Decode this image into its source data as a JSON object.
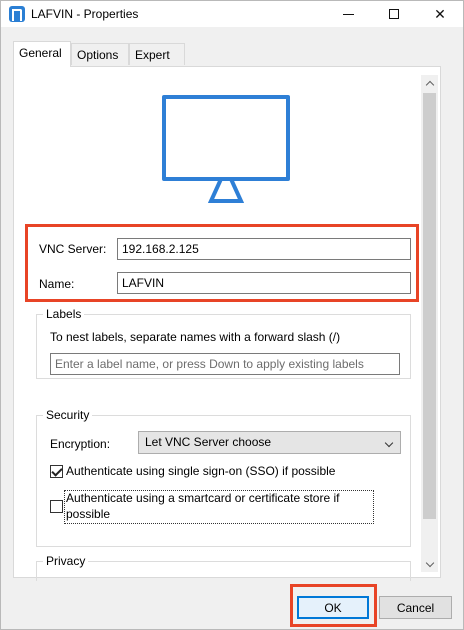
{
  "window": {
    "title": "LAFVIN - Properties",
    "icon": "realvnc-logo-icon",
    "controls": {
      "minimize": "minimize-icon",
      "maximize": "maximize-icon",
      "close": "✕"
    }
  },
  "tabs": [
    {
      "label": "General",
      "active": true
    },
    {
      "label": "Options",
      "active": false
    },
    {
      "label": "Expert",
      "active": false
    }
  ],
  "general": {
    "illustration": "monitor-icon",
    "vnc_server_label": "VNC Server:",
    "vnc_server_value": "192.168.2.125",
    "name_label": "Name:",
    "name_value": "LAFVIN",
    "labels_section": {
      "title": "Labels",
      "description": "To nest labels, separate names with a forward slash (/)",
      "placeholder": "Enter a label name, or press Down to apply existing labels"
    },
    "security_section": {
      "title": "Security",
      "encryption_label": "Encryption:",
      "encryption_value": "Let VNC Server choose",
      "sso_label": "Authenticate using single sign-on (SSO) if possible",
      "sso_checked": true,
      "smartcard_label_line1": "Authenticate using a smartcard or certificate store if",
      "smartcard_label_line2": "possible",
      "smartcard_checked": false
    },
    "privacy_section": {
      "title": "Privacy"
    }
  },
  "buttons": {
    "ok": "OK",
    "cancel": "Cancel"
  },
  "colors": {
    "accent": "#2e7fd6",
    "highlight": "#e84426",
    "focus": "#0078d7"
  }
}
